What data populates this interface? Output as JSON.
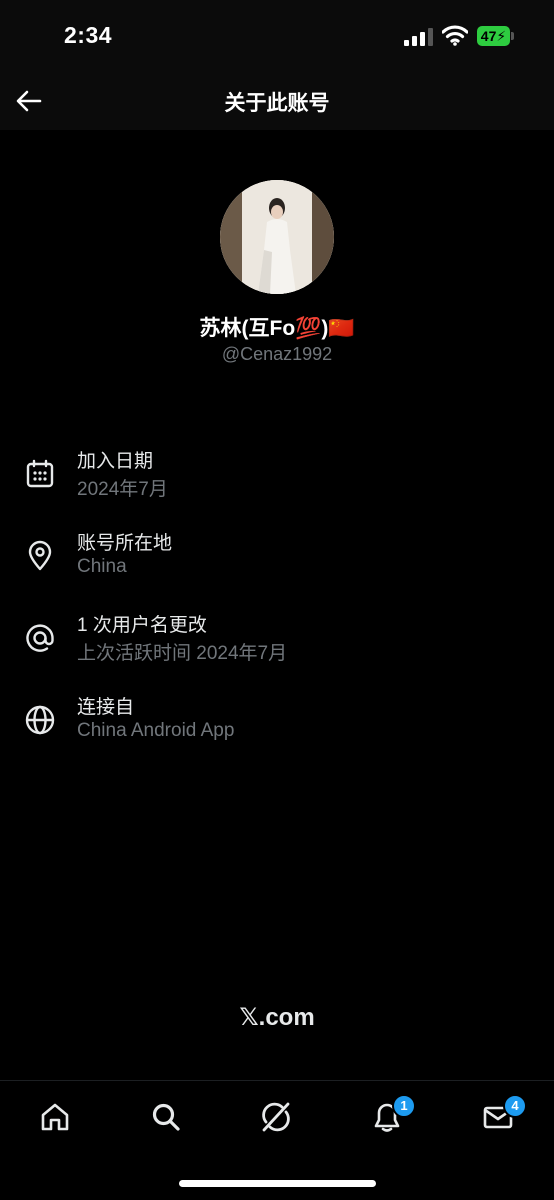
{
  "status_bar": {
    "time": "2:34",
    "battery_level": "47"
  },
  "header": {
    "title": "关于此账号",
    "back_icon": "arrow-left-icon"
  },
  "profile": {
    "display_name": "苏林(互Fo💯)🇨🇳",
    "handle": "@Cenaz1992"
  },
  "info_rows": [
    {
      "icon": "calendar-icon",
      "title": "加入日期",
      "subtitle": "2024年7月"
    },
    {
      "icon": "location-pin-icon",
      "title": "账号所在地",
      "subtitle": "China"
    },
    {
      "icon": "at-sign-icon",
      "title": "1 次用户名更改",
      "subtitle": "上次活跃时间 2024年7月"
    },
    {
      "icon": "globe-icon",
      "title": "连接自",
      "subtitle": "China Android App"
    }
  ],
  "footer": {
    "logo_text": "𝕏.com"
  },
  "tab_bar": {
    "notifications_badge": "1",
    "messages_badge": "4"
  },
  "colors": {
    "accent": "#1d9bf0",
    "battery": "#2ecc40",
    "secondary_text": "#71767b"
  }
}
